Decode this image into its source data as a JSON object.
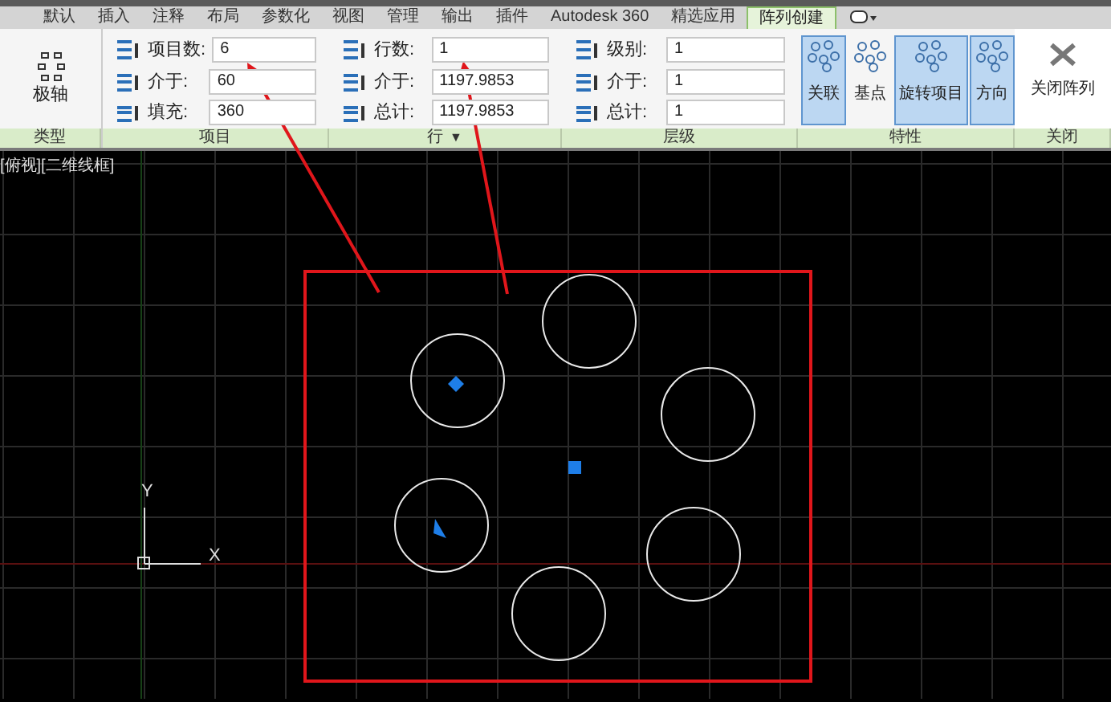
{
  "tabs": [
    {
      "label": "默认",
      "selected": false
    },
    {
      "label": "插入",
      "selected": false
    },
    {
      "label": "注释",
      "selected": false
    },
    {
      "label": "布局",
      "selected": false
    },
    {
      "label": "参数化",
      "selected": false
    },
    {
      "label": "视图",
      "selected": false
    },
    {
      "label": "管理",
      "selected": false
    },
    {
      "label": "输出",
      "selected": false
    },
    {
      "label": "插件",
      "selected": false
    },
    {
      "label": "Autodesk 360",
      "selected": false
    },
    {
      "label": "精选应用",
      "selected": false
    },
    {
      "label": "阵列创建",
      "selected": true
    }
  ],
  "type_group": {
    "button": "极轴",
    "label": "类型"
  },
  "items_group": {
    "label": "项目",
    "fields": [
      {
        "label": "项目数:",
        "value": "6"
      },
      {
        "label": "介于:",
        "value": "60"
      },
      {
        "label": "填充:",
        "value": "360"
      }
    ]
  },
  "rows_group": {
    "label": "行",
    "caret": "▼",
    "fields": [
      {
        "label": "行数:",
        "value": "1"
      },
      {
        "label": "介于:",
        "value": "1197.9853"
      },
      {
        "label": "总计:",
        "value": "1197.9853"
      }
    ]
  },
  "levels_group": {
    "label": "层级",
    "fields": [
      {
        "label": "级别:",
        "value": "1"
      },
      {
        "label": "介于:",
        "value": "1"
      },
      {
        "label": "总计:",
        "value": "1"
      }
    ]
  },
  "properties_group": {
    "label": "特性",
    "buttons": [
      {
        "label": "关联",
        "selected": true
      },
      {
        "label": "基点",
        "selected": false
      },
      {
        "label": "旋转项目",
        "selected": true
      },
      {
        "label": "方向",
        "selected": true
      }
    ]
  },
  "close_group": {
    "label": "关闭",
    "button": "关闭阵列"
  },
  "viewport": {
    "label": "[俯视][二维线框]",
    "axis_x": "X",
    "axis_y": "Y"
  }
}
